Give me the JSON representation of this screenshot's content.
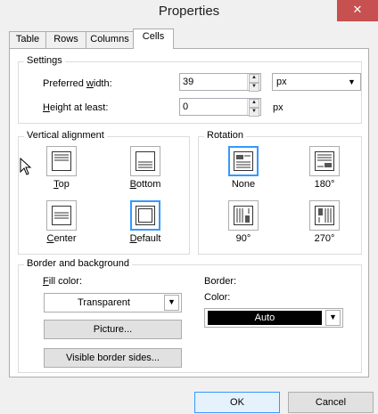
{
  "window": {
    "title": "Properties",
    "close_glyph": "✕"
  },
  "tabs": [
    {
      "label": "Table",
      "active": false
    },
    {
      "label": "Rows",
      "active": false
    },
    {
      "label": "Columns",
      "active": false
    },
    {
      "label": "Cells",
      "active": true
    }
  ],
  "settings": {
    "title": "Settings",
    "preferred_width": {
      "label_pre": "Preferred ",
      "label_u": "w",
      "label_post": "idth:",
      "value": "39",
      "unit": "px"
    },
    "height_at_least": {
      "label_u": "H",
      "label_post": "eight at least:",
      "value": "0",
      "unit": "px"
    }
  },
  "vertical_alignment": {
    "title": "Vertical alignment",
    "options": [
      {
        "u": "T",
        "rest": "op",
        "selected": false,
        "icon": "align-top-icon"
      },
      {
        "u": "B",
        "rest": "ottom",
        "selected": false,
        "icon": "align-bottom-icon"
      },
      {
        "u": "C",
        "rest": "enter",
        "selected": false,
        "icon": "align-center-icon"
      },
      {
        "u": "D",
        "rest": "efault",
        "selected": true,
        "icon": "align-default-icon"
      }
    ]
  },
  "rotation": {
    "title": "Rotation",
    "options": [
      {
        "label": "None",
        "selected": true,
        "icon": "rotate-none-icon"
      },
      {
        "label": "180°",
        "selected": false,
        "icon": "rotate-180-icon"
      },
      {
        "label": "90°",
        "selected": false,
        "icon": "rotate-90-icon"
      },
      {
        "label": "270°",
        "selected": false,
        "icon": "rotate-270-icon"
      }
    ]
  },
  "border_background": {
    "title": "Border and background",
    "fill_color": {
      "label_u": "F",
      "label_post": "ill color:",
      "value": "Transparent"
    },
    "picture_button": "Picture...",
    "visible_border_button": "Visible border sides...",
    "border_label": "Border:",
    "color": {
      "label": "Color:",
      "value": "Auto",
      "swatch": "#000000"
    }
  },
  "footer": {
    "ok": "OK",
    "cancel": "Cancel"
  },
  "colors": {
    "accent": "#3399ff",
    "close": "#c75050"
  }
}
